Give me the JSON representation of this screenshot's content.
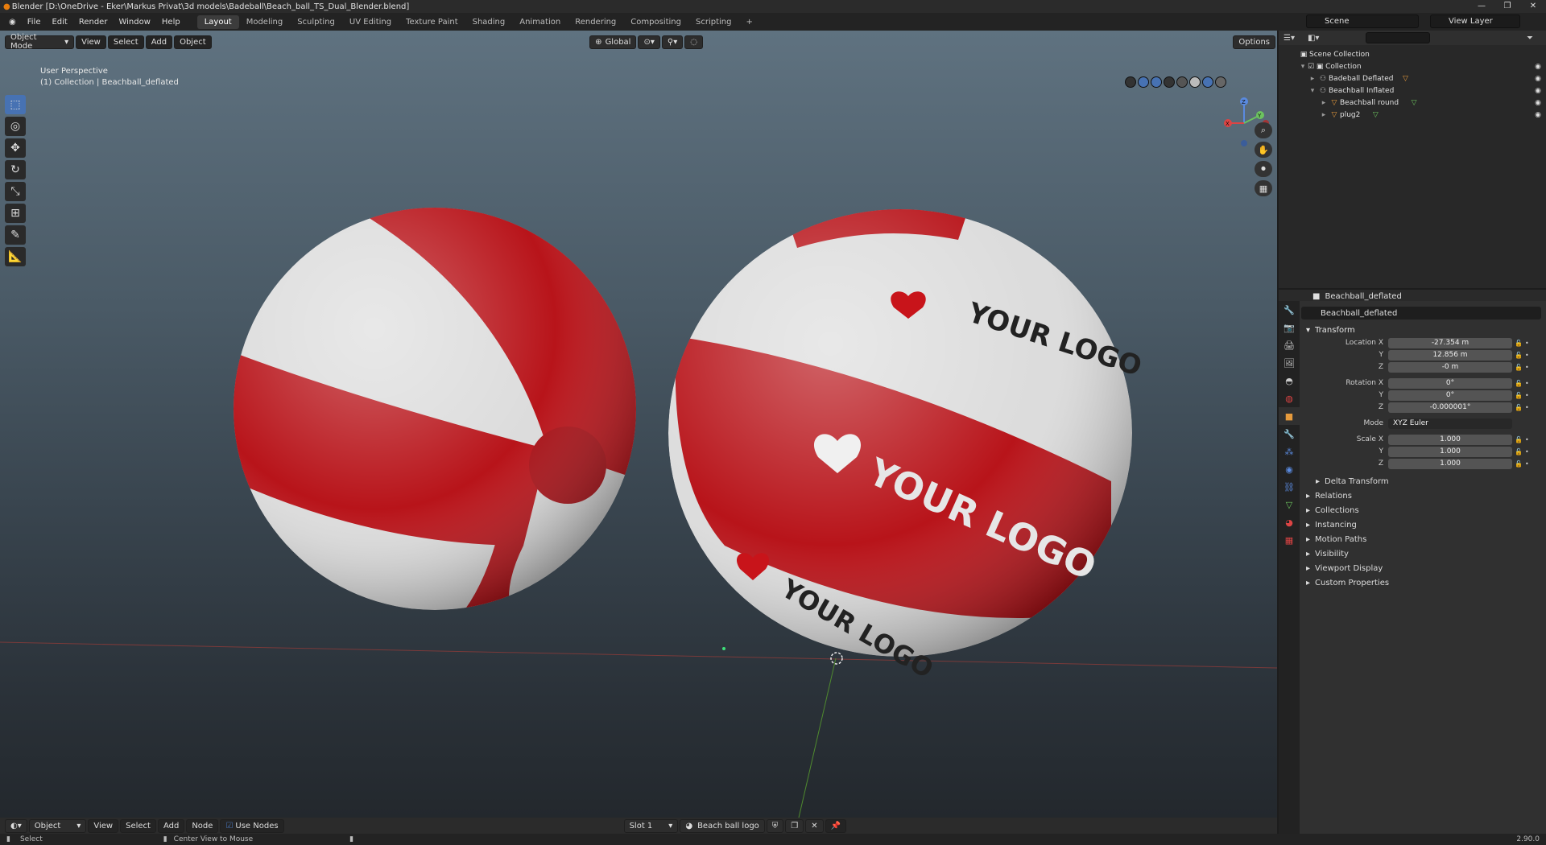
{
  "window": {
    "title": "Blender [D:\\OneDrive - Eker\\Markus Privat\\3d models\\Badeball\\Beach_ball_TS_Dual_Blender.blend]",
    "controls": [
      "—",
      "❐",
      "✕"
    ]
  },
  "menu": {
    "items": [
      "File",
      "Edit",
      "Render",
      "Window",
      "Help"
    ],
    "workspaces": [
      "Layout",
      "Modeling",
      "Sculpting",
      "UV Editing",
      "Texture Paint",
      "Shading",
      "Animation",
      "Rendering",
      "Compositing",
      "Scripting",
      "+"
    ],
    "active_workspace": "Layout",
    "scene": "Scene",
    "view_layer": "View Layer"
  },
  "viewport": {
    "mode": "Object Mode",
    "menus": [
      "View",
      "Select",
      "Add",
      "Object"
    ],
    "transform_orientation": "Global",
    "options_label": "Options",
    "perspective_label": "User Perspective",
    "collection_label": "(1) Collection | Beachball_deflated",
    "logo_text": "YOUR LOGO",
    "gizmo_axes": [
      "X",
      "Y",
      "Z"
    ]
  },
  "bottom_bar": {
    "editor": "Object",
    "menus": [
      "View",
      "Select",
      "Add",
      "Node"
    ],
    "use_nodes_label": "Use Nodes",
    "slot": "Slot 1",
    "material": "Beach ball logo"
  },
  "status_bar": {
    "select": "Select",
    "center_view": "Center View to Mouse",
    "version": "2.90.0"
  },
  "outliner": {
    "search_placeholder": "",
    "items": [
      {
        "label": "Scene Collection",
        "level": 0,
        "icon": "collection-icon"
      },
      {
        "label": "Collection",
        "level": 1,
        "icon": "collection-icon"
      },
      {
        "label": "Badeball Deflated",
        "level": 2,
        "icon": "armature-icon"
      },
      {
        "label": "Beachball Inflated",
        "level": 2,
        "icon": "armature-icon"
      },
      {
        "label": "Beachball round",
        "level": 3,
        "icon": "mesh-icon"
      },
      {
        "label": "plug2",
        "level": 3,
        "icon": "mesh-icon"
      }
    ]
  },
  "properties": {
    "object_name": "Beachball_deflated",
    "object_field": "Beachball_deflated",
    "transform_label": "Transform",
    "location": {
      "label": "Location X",
      "x": "-27.354 m",
      "y": "12.856 m",
      "z": "-0 m"
    },
    "rotation": {
      "label": "Rotation X",
      "x": "0°",
      "y": "0°",
      "z": "-0.000001°"
    },
    "mode": {
      "label": "Mode",
      "value": "XYZ Euler"
    },
    "scale": {
      "label": "Scale X",
      "x": "1.000",
      "y": "1.000",
      "z": "1.000"
    },
    "axis_y": "Y",
    "axis_z": "Z",
    "delta_label": "Delta Transform",
    "sections": [
      "Relations",
      "Collections",
      "Instancing",
      "Motion Paths",
      "Visibility",
      "Viewport Display",
      "Custom Properties"
    ]
  },
  "colors": {
    "accent": "#4772b3",
    "ball_red": "#b8141a",
    "ball_white": "#dcdcdc",
    "mesh_orange": "#e59a3c",
    "data_green": "#6cc35f"
  }
}
